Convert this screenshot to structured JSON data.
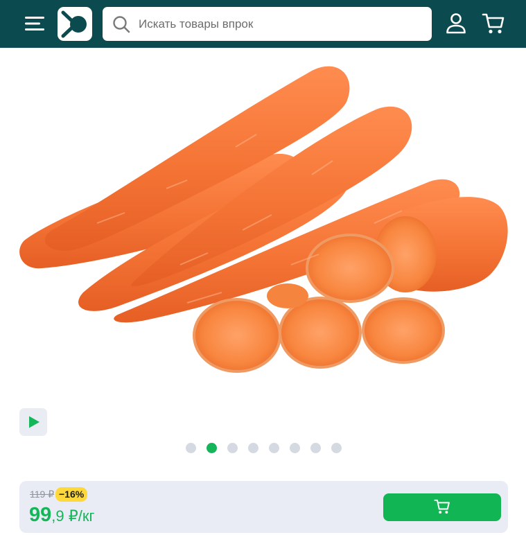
{
  "header": {
    "menu_icon": "hamburger-menu-icon",
    "logo_icon": "app-logo",
    "search": {
      "placeholder": "Искать товары впрок",
      "value": "",
      "icon": "search-icon"
    },
    "user_icon": "user-icon",
    "cart_icon": "cart-icon",
    "background_color": "#0b4a4f"
  },
  "gallery": {
    "image_subject": "carrots",
    "video_icon": "play-icon",
    "dots_count": 8,
    "active_dot": 2,
    "active_color": "#15b55a",
    "inactive_color": "#d5d9e2"
  },
  "price_bar": {
    "old_price": "119 ₽",
    "discount": "−16%",
    "price_integer": "99",
    "price_rest": ",9 ₽/кг",
    "add_to_cart_icon": "cart-icon",
    "accent_color": "#15b55a",
    "discount_color": "#ffd93b"
  }
}
